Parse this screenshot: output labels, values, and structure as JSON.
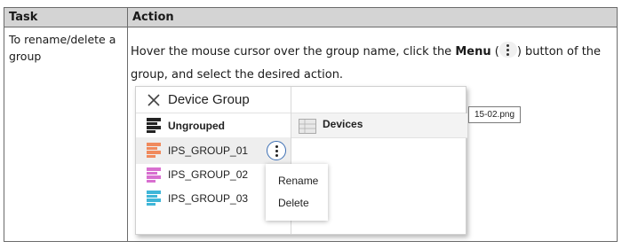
{
  "table": {
    "header": {
      "task": "Task",
      "action": "Action"
    },
    "row": {
      "task": "To rename/delete a group",
      "action": {
        "before": "Hover the mouse cursor over the group name, click the ",
        "menu_word": "Menu",
        "paren_open": " (",
        "paren_close": ") button of the group, and select the desired action."
      }
    }
  },
  "screenshot": {
    "title": "Device Group",
    "ungrouped": "Ungrouped",
    "devices": "Devices",
    "groups": [
      {
        "label": "IPS_GROUP_01",
        "color": "#f08a5d"
      },
      {
        "label": "IPS_GROUP_02",
        "color": "#d86fd0"
      },
      {
        "label": "IPS_GROUP_03",
        "color": "#3fb6d8"
      }
    ],
    "context_menu": [
      "Rename",
      "Delete"
    ],
    "icons": {
      "close": "close-icon",
      "ungrouped": "device-stack-icon",
      "devices": "device-list-icon",
      "menu": "kebab-menu-icon"
    }
  },
  "image_tag": "15-02.png"
}
